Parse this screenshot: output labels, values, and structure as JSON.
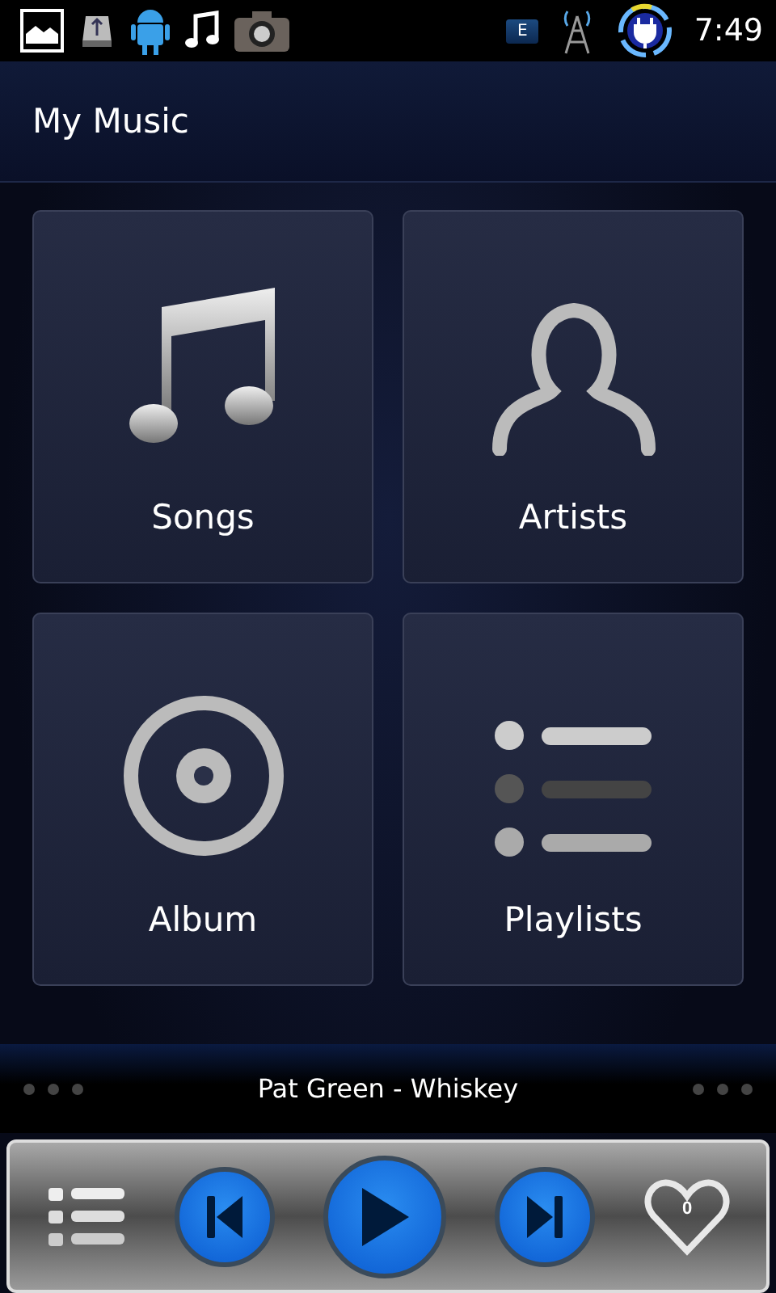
{
  "status_bar": {
    "network": "E",
    "time": "7:49"
  },
  "header": {
    "title": "My Music"
  },
  "tiles": [
    {
      "kind": "songs",
      "label": "Songs"
    },
    {
      "kind": "artists",
      "label": "Artists"
    },
    {
      "kind": "album",
      "label": "Album"
    },
    {
      "kind": "playlists",
      "label": "Playlists"
    }
  ],
  "now_playing": {
    "title": "Pat Green - Whiskey"
  },
  "controls": {
    "favorites_count": "0"
  }
}
